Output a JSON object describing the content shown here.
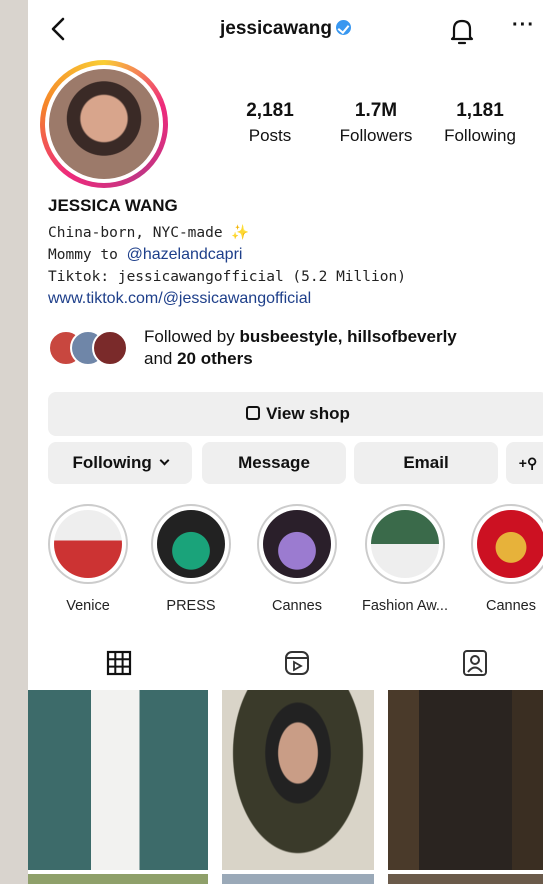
{
  "header": {
    "username": "jessicawang",
    "more_label": "···"
  },
  "stats": [
    {
      "value": "2,181",
      "label": "Posts"
    },
    {
      "value": "1.7M",
      "label": "Followers"
    },
    {
      "value": "1,181",
      "label": "Following"
    }
  ],
  "bio": {
    "name": "JESSICA WANG",
    "line1": "China-born, NYC-made ✨",
    "line2_prefix": "Mommy to ",
    "line2_mention": "@hazelandcapri",
    "line3": "Tiktok: jessicawangofficial (5.2 Million)",
    "link": "www.tiktok.com/@jessicawangofficial"
  },
  "followed_by": {
    "prefix": "Followed by ",
    "names": "busbeestyle, hillsofbeverly",
    "and": "and ",
    "others": "20 others"
  },
  "buttons": {
    "view_shop": "View shop",
    "following": "Following",
    "message": "Message",
    "email": "Email",
    "add_user": "+²"
  },
  "highlights": [
    {
      "label": "Venice"
    },
    {
      "label": "PRESS"
    },
    {
      "label": "Cannes"
    },
    {
      "label": "Fashion Aw..."
    },
    {
      "label": "Cannes"
    }
  ],
  "colors": {
    "verified": "#3897f0",
    "link": "#1e3f8a",
    "button_bg": "#efefef"
  }
}
